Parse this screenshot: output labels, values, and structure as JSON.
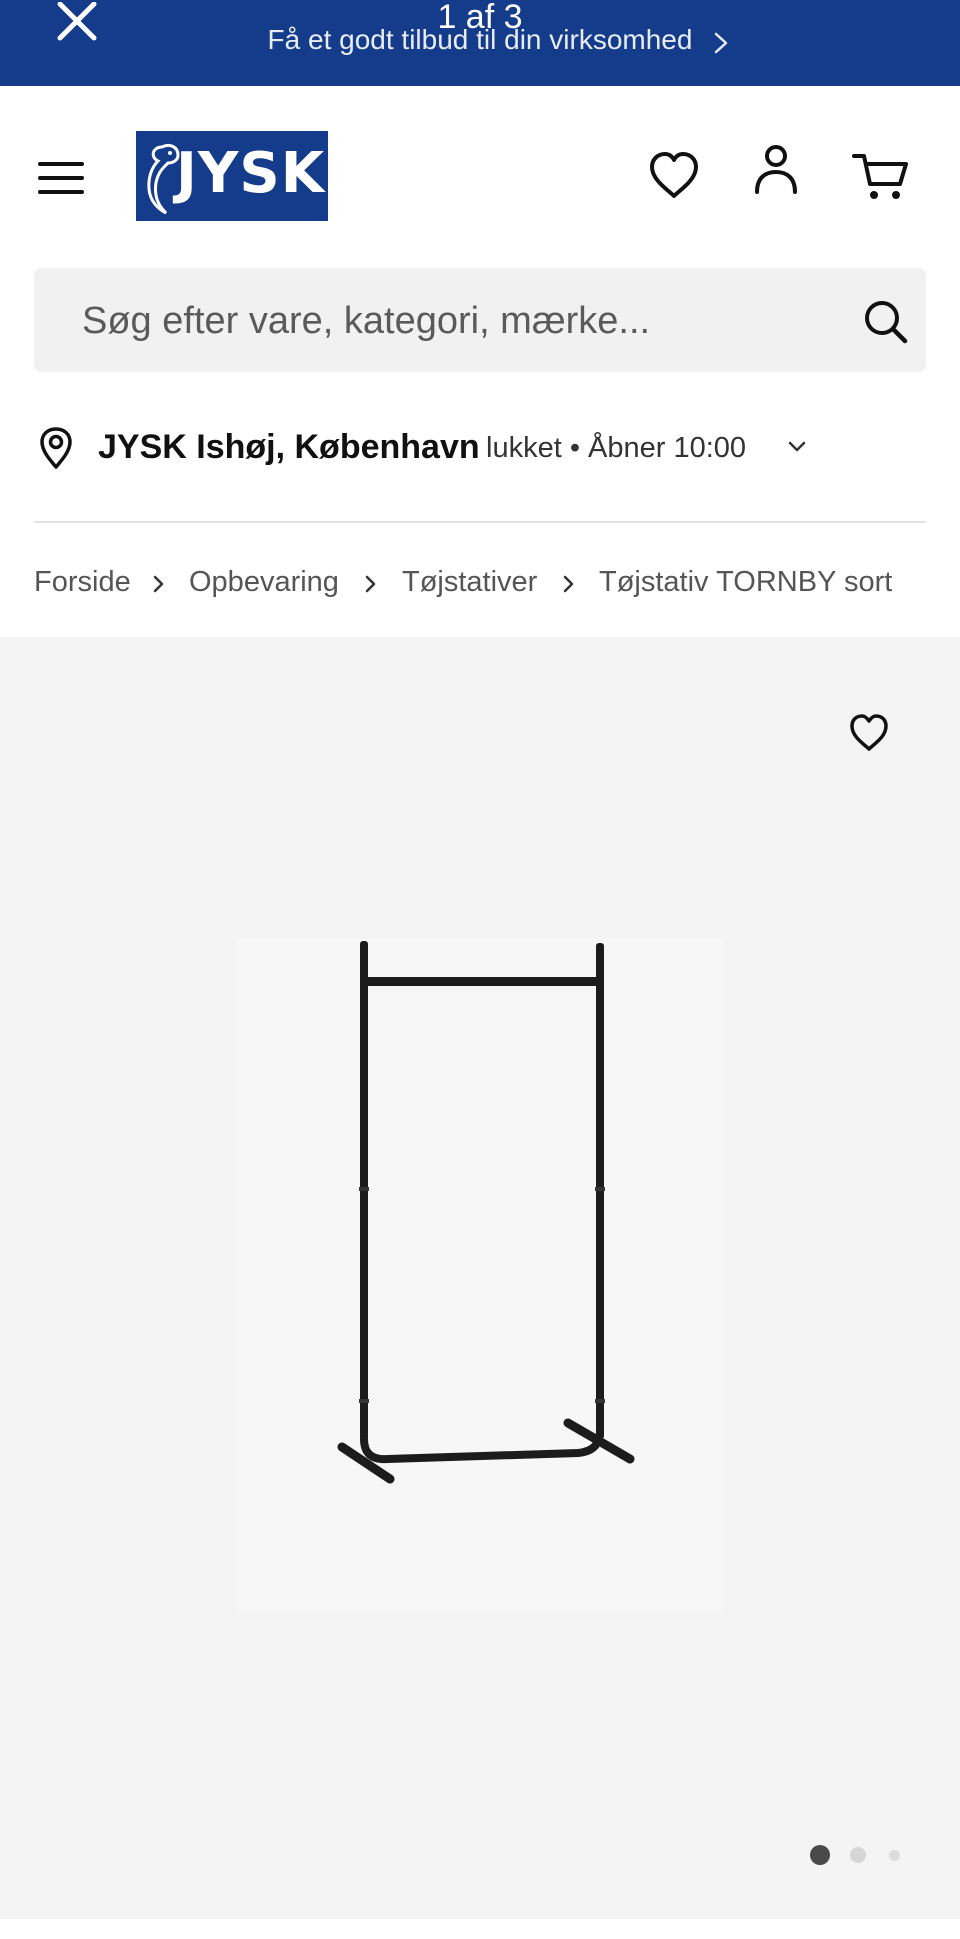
{
  "banner": {
    "counter": "1 af 3",
    "promo_text": "Få et godt tilbud til din virksomhed",
    "icons": [
      "close-icon",
      "chevron-right-icon"
    ]
  },
  "header": {
    "logo_text": "JYSK",
    "icons": [
      "menu-icon",
      "heart-icon",
      "user-icon",
      "cart-icon"
    ]
  },
  "search": {
    "placeholder": "Søg efter vare, kategori, mærke..."
  },
  "store": {
    "name": "JYSK Ishøj, København",
    "status": "lukket • Åbner 10:00"
  },
  "breadcrumb": [
    {
      "label": "Forside"
    },
    {
      "label": "Opbevaring"
    },
    {
      "label": "Tøjstativer"
    },
    {
      "label": "Tøjstativ TORNBY sort"
    }
  ],
  "gallery": {
    "active_index": 0,
    "image_count": 3
  },
  "colors": {
    "brand_blue": "#143c8a",
    "search_bg": "#f1f1f1",
    "gallery_bg": "#f4f4f4"
  }
}
